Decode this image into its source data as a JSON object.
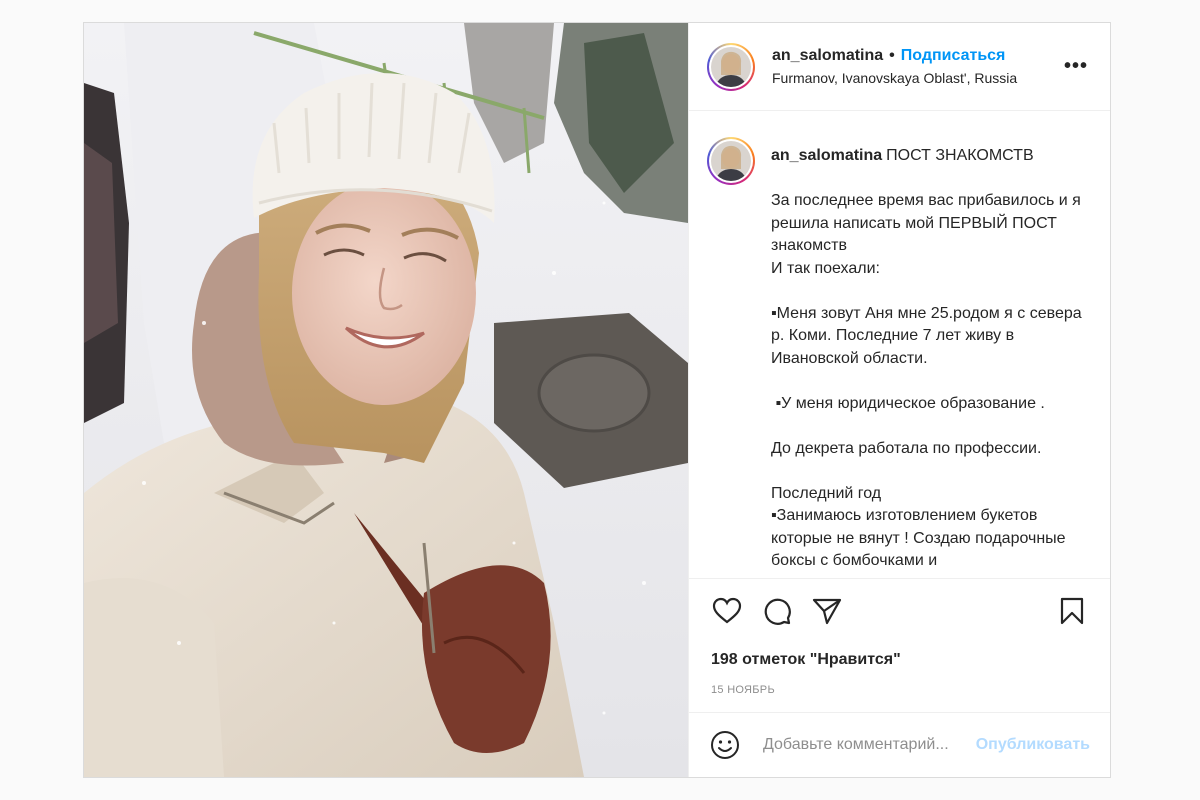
{
  "post": {
    "username": "an_salomatina",
    "follow_label": "Подписаться",
    "separator": "•",
    "location": "Furmanov, Ivanovskaya Oblast', Russia",
    "more_label": "•••",
    "caption": {
      "username": "an_salomatina",
      "title": "ПОСТ ЗНАКОМСТВ",
      "lines": [
        "За последнее время вас прибавилось и я решила написать мой ПЕРВЫЙ ПОСТ знакомств",
        "И так поехали:",
        "",
        "▪Меня зовут Аня мне 25.родом я с севера р. Коми. Последние 7 лет живу в Ивановской области.",
        "",
        " ▪У меня юридическое образование .",
        "",
        "До декрета работала по профессии.",
        "",
        "Последний год",
        "▪Занимаюсь изготовлением букетов которые не вянут ! Создаю подарочные боксы с бомбочками и"
      ]
    },
    "likes_text": "198 отметок \"Нравится\"",
    "date": "15 НОЯБРЬ",
    "comment_placeholder": "Добавьте комментарий...",
    "publish_label": "Опубликовать"
  },
  "icons": {
    "like": "heart-icon",
    "comment": "comment-icon",
    "share": "paper-plane-icon",
    "save": "bookmark-icon",
    "emoji": "smiley-icon",
    "more": "more-icon"
  },
  "colors": {
    "follow": "#0095f6",
    "publish_disabled": "#b3dbff",
    "muted": "#8e8e8e",
    "text": "#262626"
  }
}
